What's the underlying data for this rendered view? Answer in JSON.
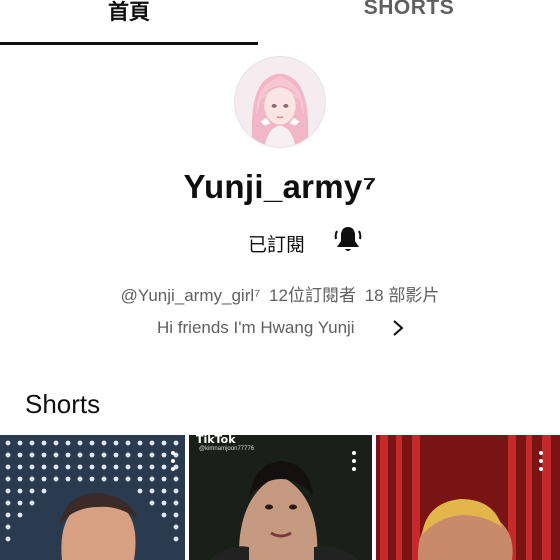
{
  "tabs": [
    {
      "label": "首頁",
      "active": true
    },
    {
      "label": "SHORTS",
      "active": false
    }
  ],
  "channel": {
    "name": "Yunji_army⁷",
    "subscribe_state": "已訂閱",
    "handle": "@Yunji_army_girl⁷",
    "subscribers": "12位訂閱者",
    "videos": "18 部影片",
    "description": "Hi friends I'm Hwang Yunji"
  },
  "shorts_section": {
    "title": "Shorts",
    "items": [
      {
        "thumbnail": "stage-lights-person"
      },
      {
        "thumbnail": "dark-portrait",
        "watermark": "TikTok",
        "watermark_user": "@kimnamjoon77776"
      },
      {
        "thumbnail": "red-stage-person"
      }
    ]
  },
  "icons": {
    "bell": "bell-icon",
    "chevron": "chevron-right-icon",
    "more": "more-vert-icon"
  },
  "colors": {
    "text_primary": "#0f0f0f",
    "text_secondary": "#606060",
    "background": "#ffffff"
  }
}
